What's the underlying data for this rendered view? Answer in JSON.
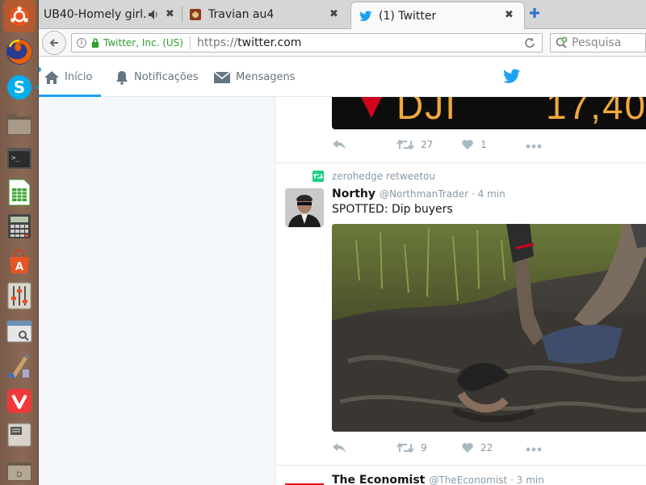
{
  "browser": {
    "tabs": [
      {
        "title": "UB40-Homely girl...",
        "icon": "youtube-icon",
        "audio": true
      },
      {
        "title": "Travian au4",
        "icon": "travian-icon"
      },
      {
        "title": "(1) Twitter",
        "icon": "twitter-bird-icon",
        "active": true
      }
    ],
    "identity": "Twitter, Inc. (US)",
    "url_scheme": "https://",
    "url_host": "twitter.com",
    "search_placeholder": "Pesquisa"
  },
  "twitter": {
    "nav": {
      "home": "Início",
      "notifications": "Notificações",
      "messages": "Mensagens"
    },
    "tweets": [
      {
        "image_text_1": "DJI",
        "image_text_2": "17,40",
        "retweets": "27",
        "likes": "1"
      },
      {
        "retweeted_by": "zerohedge retweetou",
        "name": "Northy",
        "handle": "@NorthmanTrader",
        "time": "· 4 min",
        "text": "SPOTTED: Dip buyers",
        "retweets": "9",
        "likes": "22"
      },
      {
        "name": "The Economist",
        "handle": "@TheEconomist",
        "time": "· 3 min"
      }
    ]
  },
  "colors": {
    "twitter_blue": "#1da1f2",
    "retweet_green": "#19cf86",
    "secure_green": "#2f9e2f",
    "ticker_red": "#d0021b",
    "ticker_orange": "#f2a93b"
  }
}
